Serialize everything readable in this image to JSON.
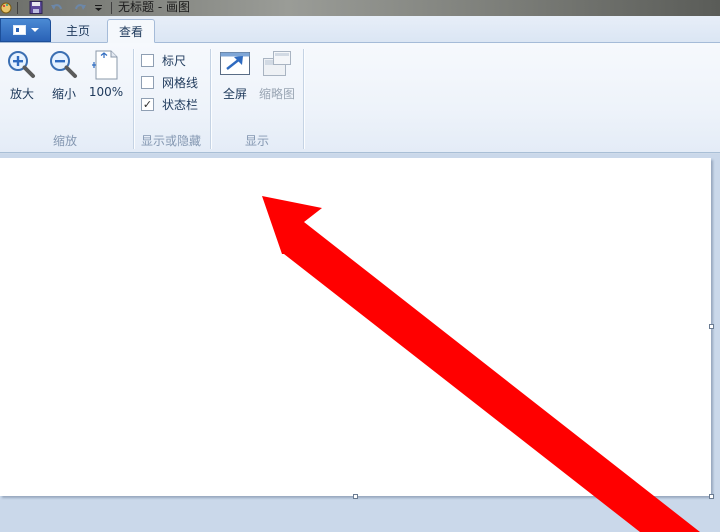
{
  "window": {
    "title": "无标题 - 画图"
  },
  "tabs": [
    {
      "label": "主页",
      "selected": false
    },
    {
      "label": "查看",
      "selected": true
    }
  ],
  "ribbon": {
    "zoom_group": {
      "label": "缩放",
      "zoom_in": "放大",
      "zoom_out": "缩小",
      "actual_size": "100%"
    },
    "show_hide_group": {
      "label": "显示或隐藏",
      "ruler": {
        "label": "标尺",
        "checked": false
      },
      "gridlines": {
        "label": "网格线",
        "checked": false
      },
      "status_bar": {
        "label": "状态栏",
        "checked": true,
        "mark": "✓"
      }
    },
    "display_group": {
      "label": "显示",
      "fullscreen": "全屏",
      "thumbnail": "缩略图"
    }
  },
  "colors": {
    "accent": "#2a62b6",
    "annotation_arrow": "#ff0000",
    "canvas": "#ffffff",
    "workspace": "#cad8ea"
  },
  "icons": {
    "zoom_in": "magnifier-plus-icon",
    "zoom_out": "magnifier-minus-icon",
    "actual_size": "page-100-icon",
    "fullscreen": "fullscreen-icon",
    "thumbnail": "thumbnail-icon"
  }
}
